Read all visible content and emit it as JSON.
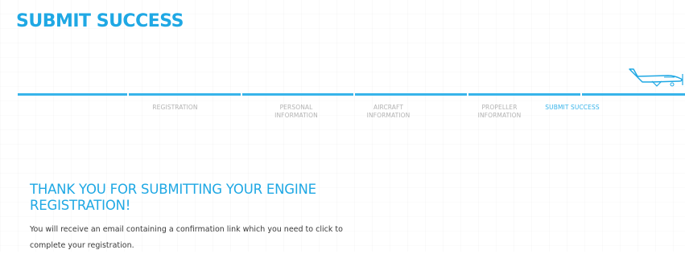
{
  "header": {
    "title": "SUBMIT SUCCESS"
  },
  "steps": [
    {
      "label": "",
      "active": false
    },
    {
      "label": "REGISTRATION",
      "active": false
    },
    {
      "label": "PERSONAL INFORMATION",
      "active": false
    },
    {
      "label": "AIRCRAFT INFORMATION",
      "active": false
    },
    {
      "label": "PROPELLER INFORMATION",
      "active": false
    },
    {
      "label": "SUBMIT SUCCESS",
      "active": true
    },
    {
      "label": "",
      "active": false
    }
  ],
  "message": {
    "heading": "THANK YOU FOR SUBMITTING YOUR ENGINE REGISTRATION!",
    "body": "You will receive an email containing a confirmation link which you need to click to complete your registration."
  },
  "icons": {
    "plane": "airplane-icon"
  },
  "colors": {
    "accent": "#1fa8e4",
    "progress_bar": "#38b4ea",
    "step_inactive": "#b3b3b3",
    "body_text": "#3a3a3a"
  }
}
